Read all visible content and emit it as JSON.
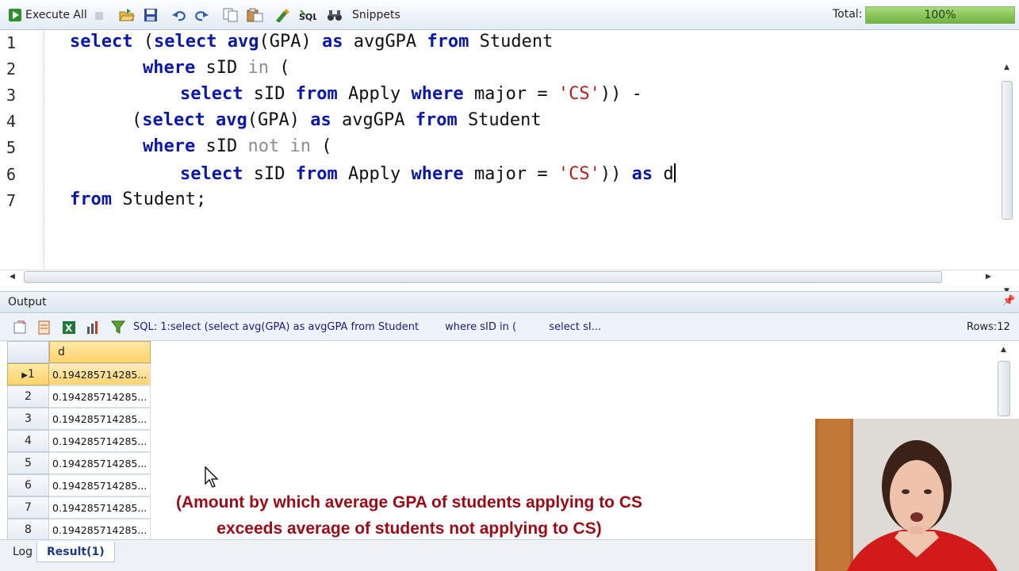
{
  "toolbar": {
    "execute_all_label": "Execute All",
    "snippets_label": "Snippets",
    "total_label": "Total:",
    "progress_text": "100%",
    "progress_value": 1.0
  },
  "editor": {
    "lines": [
      {
        "num": "1"
      },
      {
        "num": "2"
      },
      {
        "num": "3"
      },
      {
        "num": "4"
      },
      {
        "num": "5"
      },
      {
        "num": "6"
      },
      {
        "num": "7"
      }
    ],
    "tokens": {
      "select": "select",
      "avg": "avg",
      "gpa": "(GPA)",
      "as": "as",
      "avgGPA": "avgGPA",
      "from": "from",
      "student": "Student",
      "where": "where",
      "sid": "sID",
      "in": "in",
      "open": "(",
      "apply": "Apply",
      "major": "major",
      "eq": "=",
      "cs": "'CS'",
      "close_minus": ")) -",
      "open_select": "(select",
      "not_in": "not in",
      "close": "))",
      "d": "d",
      "student_semi": "Student;",
      "open_paren_select": "(select"
    }
  },
  "output": {
    "title": "Output",
    "sql_text": "SQL: 1:select (select avg(GPA) as avgGPA from Student        where sID in (          select sI...",
    "rows_label": "Rows:12"
  },
  "grid": {
    "column_header": "d",
    "rows": [
      {
        "label": "1",
        "value": "0.194285714285..."
      },
      {
        "label": "2",
        "value": "0.194285714285..."
      },
      {
        "label": "3",
        "value": "0.194285714285..."
      },
      {
        "label": "4",
        "value": "0.194285714285..."
      },
      {
        "label": "5",
        "value": "0.194285714285..."
      },
      {
        "label": "6",
        "value": "0.194285714285..."
      },
      {
        "label": "7",
        "value": "0.194285714285..."
      },
      {
        "label": "8",
        "value": "0.194285714285..."
      }
    ]
  },
  "annotation": {
    "line1": "(Amount by which average GPA of students applying to CS",
    "line2": "exceeds average of students not applying to CS)"
  },
  "tabs": {
    "log": "Log",
    "result": "Result(1)"
  },
  "colors": {
    "keyword": "#0a17a8",
    "string": "#b21f1f",
    "annotation": "#9b0a17",
    "selection": "#ffd36b"
  },
  "icons": [
    "execute-icon",
    "stop-icon",
    "open-folder-icon",
    "save-icon",
    "undo-icon",
    "redo-icon",
    "copy-icon",
    "paste-icon",
    "format-icon",
    "sql-icon",
    "binoculars-icon",
    "pin-icon",
    "export-icon",
    "excel-icon",
    "chart-icon",
    "filter-icon",
    "mouse-cursor-icon"
  ]
}
